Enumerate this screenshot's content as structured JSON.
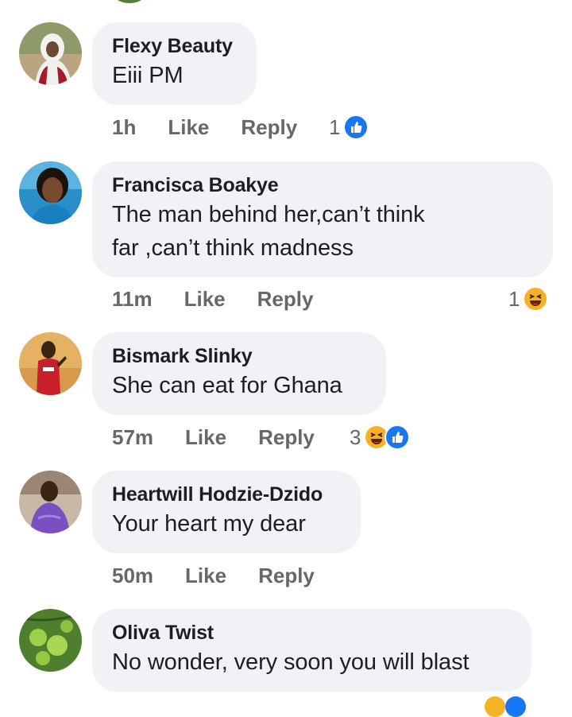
{
  "comments": [
    {
      "author": "Flexy Beauty",
      "text": [
        "Eiii PM"
      ],
      "time": "1h",
      "like": "Like",
      "reply": "Reply",
      "reaction_count": "1",
      "reactions": [
        "like-icon"
      ]
    },
    {
      "author": "Francisca Boakye",
      "text": [
        "The man behind her,can’t think",
        "far ,can’t think madness"
      ],
      "time": "11m",
      "like": "Like",
      "reply": "Reply",
      "reaction_count": "1",
      "reactions": [
        "haha-icon"
      ]
    },
    {
      "author": "Bismark Slinky",
      "text": [
        "She can eat for Ghana"
      ],
      "time": "57m",
      "like": "Like",
      "reply": "Reply",
      "reaction_count": "3",
      "reactions": [
        "haha-icon",
        "like-icon"
      ]
    },
    {
      "author": "Heartwill Hodzie-Dzido",
      "text": [
        "Your heart my dear"
      ],
      "time": "50m",
      "like": "Like",
      "reply": "Reply",
      "reaction_count": "",
      "reactions": []
    },
    {
      "author": "Oliva Twist",
      "text": [
        "No wonder, very soon you will blast"
      ],
      "time": "",
      "like": "",
      "reply": "",
      "reaction_count": "",
      "reactions": []
    }
  ],
  "colors": {
    "bubble": "#f0f2f5",
    "like": "#1877f2",
    "haha": "#f7b125",
    "meta": "#65676b",
    "text": "#1c1e21"
  }
}
